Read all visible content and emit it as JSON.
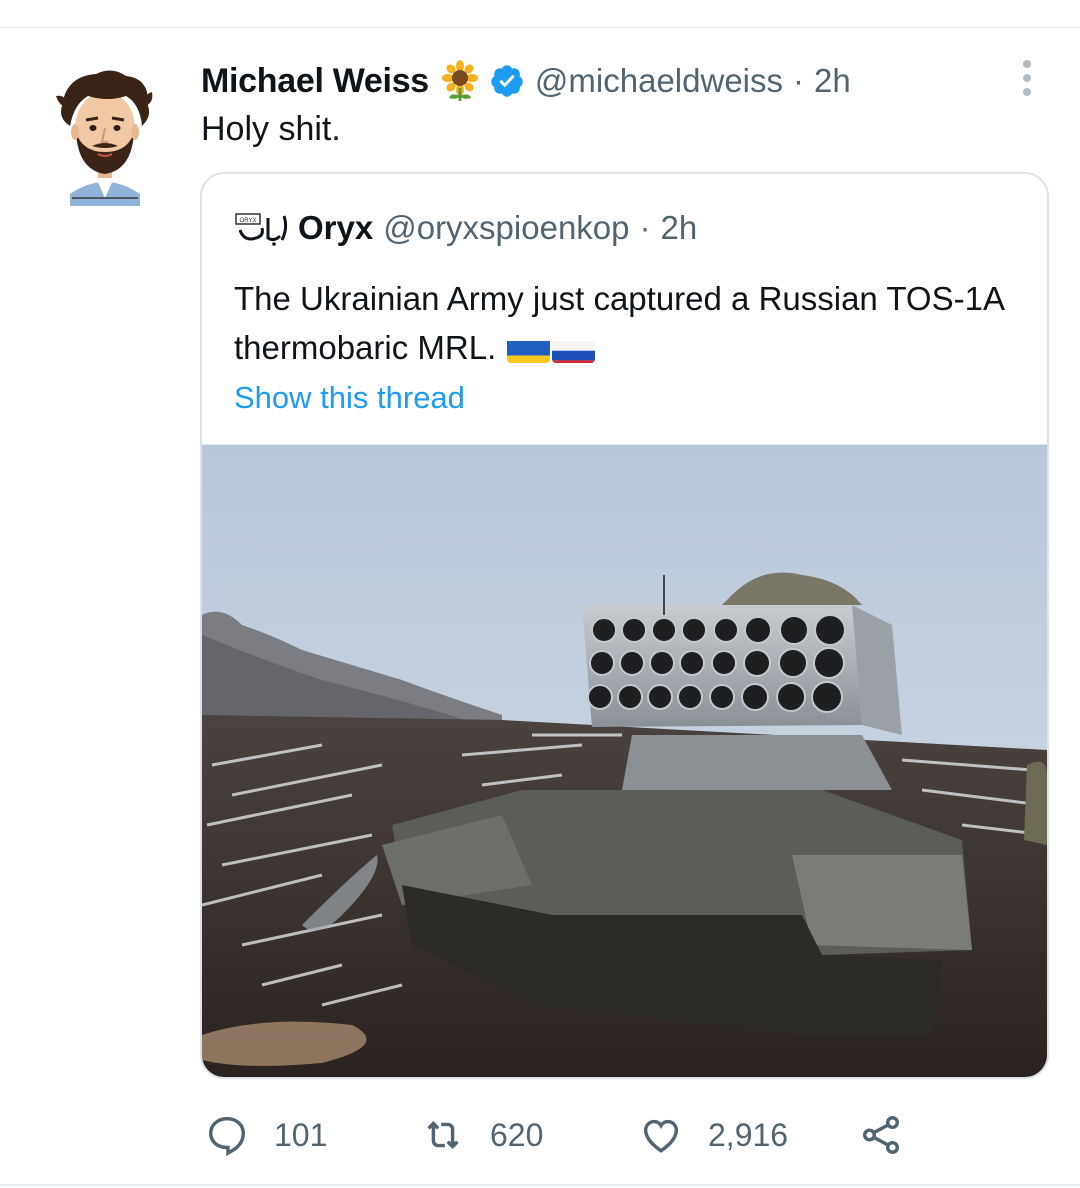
{
  "tweet": {
    "author": {
      "name": "Michael Weiss",
      "handle": "@michaeldweiss",
      "badge_icon": "sunflower-icon",
      "verified_icon": "verified-badge-icon"
    },
    "separator": "·",
    "time": "2h",
    "text": "Holy shit.",
    "more_icon": "more-options-icon"
  },
  "quoted": {
    "author": {
      "name": "Oryx",
      "handle": "@oryxspioenkop",
      "logo_icon": "oryx-logo-icon"
    },
    "separator": "·",
    "time": "2h",
    "text": "The Ukrainian Army just captured a Russian TOS-1A thermobaric MRL.",
    "flags": [
      "ukraine-flag-icon",
      "russia-flag-icon"
    ],
    "show_thread": "Show this thread",
    "image": "photo-captured-tos1a-in-muddy-field"
  },
  "actions": {
    "reply": {
      "icon": "reply-icon",
      "count": "101"
    },
    "retweet": {
      "icon": "retweet-icon",
      "count": "620"
    },
    "like": {
      "icon": "heart-icon",
      "count": "2,916"
    },
    "share": {
      "icon": "share-icon"
    }
  },
  "colors": {
    "text": "#0f1419",
    "secondary": "#536471",
    "link": "#1d9bf0",
    "verified": "#1d9bf0",
    "border": "#dde2e6"
  }
}
